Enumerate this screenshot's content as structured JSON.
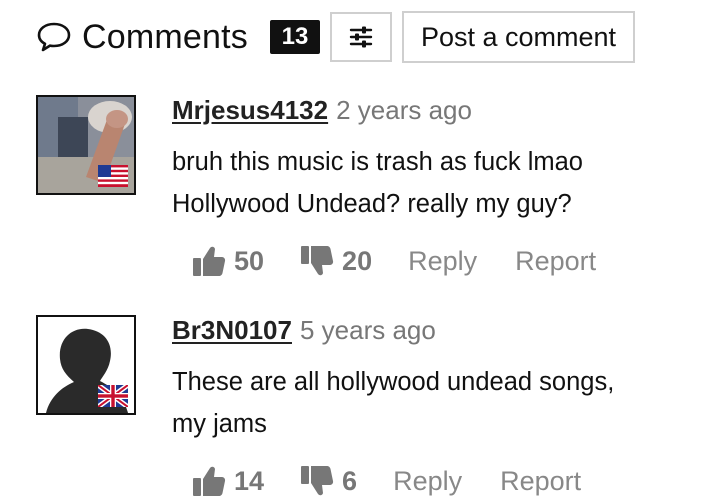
{
  "header": {
    "title": "Comments",
    "count": "13",
    "filter_icon": "sliders-icon",
    "post_label": "Post a comment"
  },
  "comments": [
    {
      "username": "Mrjesus4132",
      "timestamp": "2 years ago",
      "lines": [
        "bruh this music is trash as fuck lmao",
        "Hollywood Undead? really my guy?"
      ],
      "likes": "50",
      "dislikes": "20",
      "reply_label": "Reply",
      "report_label": "Report",
      "flag": "us-flag-icon"
    },
    {
      "username": "Br3N0107",
      "timestamp": "5 years ago",
      "lines": [
        "These are all hollywood undead songs,",
        "my jams"
      ],
      "likes": "14",
      "dislikes": "6",
      "reply_label": "Reply",
      "report_label": "Report",
      "flag": "uk-flag-icon"
    }
  ],
  "colors": {
    "text": "#111111",
    "muted": "#777777",
    "badge_bg": "#111111",
    "border": "#cfcfcf",
    "icon": "#777777"
  }
}
